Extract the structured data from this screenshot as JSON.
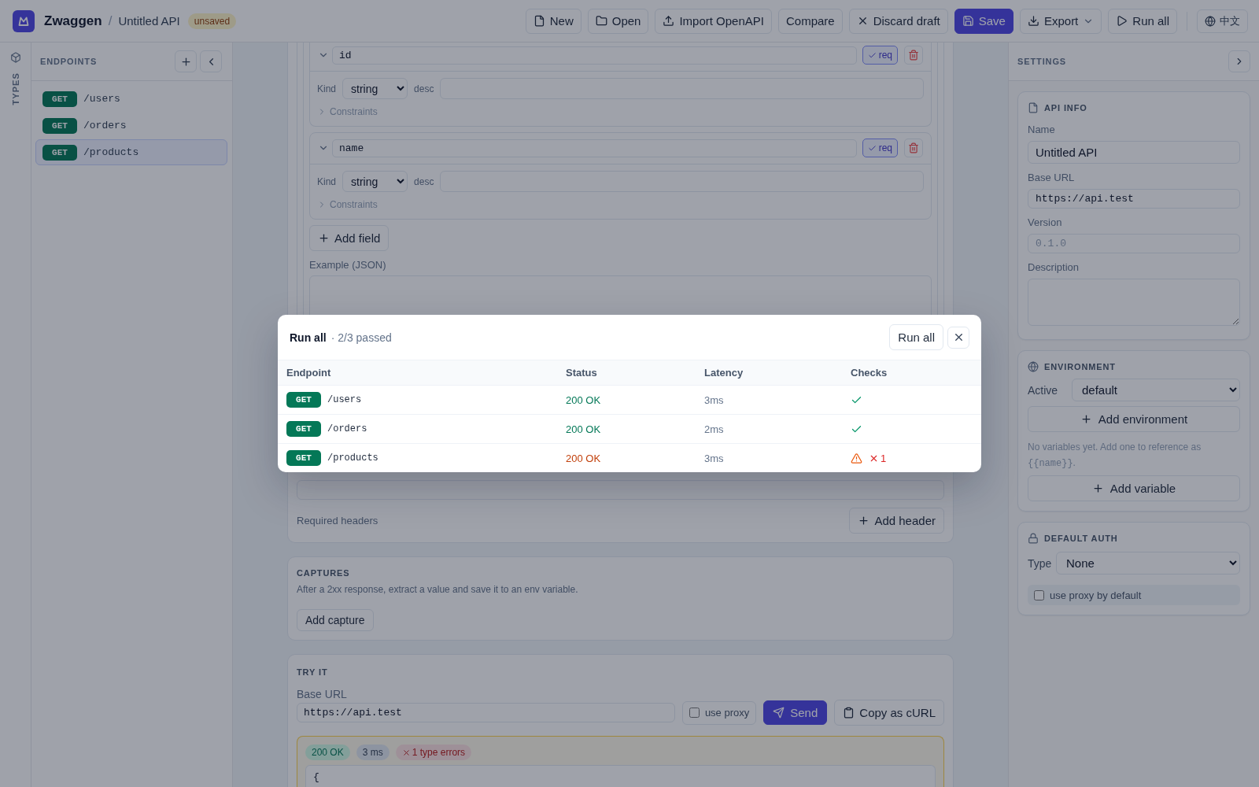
{
  "topbar": {
    "app_name": "Zwaggen",
    "separator": "/",
    "api_name": "Untitled API",
    "status_badge": "unsaved",
    "actions": [
      {
        "label": "New",
        "kind": "default"
      },
      {
        "label": "Open",
        "kind": "default"
      },
      {
        "label": "Import OpenAPI",
        "kind": "default"
      },
      {
        "label": "Compare",
        "kind": "default"
      },
      {
        "label": "Discard draft",
        "kind": "default"
      },
      {
        "label": "Save",
        "kind": "primary"
      },
      {
        "label": "Export",
        "kind": "menu"
      },
      {
        "label": "Run all",
        "kind": "default"
      }
    ],
    "language": "中文"
  },
  "rail": {
    "label": "TYPES"
  },
  "sidebar": {
    "title": "ENDPOINTS",
    "items": [
      {
        "method": "GET",
        "path": "/users",
        "selected": false
      },
      {
        "method": "GET",
        "path": "/orders",
        "selected": false
      },
      {
        "method": "GET",
        "path": "/products",
        "selected": true
      }
    ]
  },
  "editor": {
    "fields": [
      {
        "name": "id",
        "expanded": true,
        "required": true,
        "required_label": "req",
        "kind_label": "Kind",
        "type": "string",
        "desc_label": "desc",
        "constraints": {
          "label": "Constraints",
          "expanded": false
        }
      },
      {
        "name": "name",
        "expanded": true,
        "required": true,
        "required_label": "req",
        "kind_label": "Kind",
        "type": "string",
        "desc_label": "desc",
        "constraints": {
          "label": "Constraints",
          "expanded": false
        }
      }
    ],
    "add_field": "Add field",
    "example_label": "Example (JSON)",
    "required_headers_label": "Required headers",
    "add_header": "Add header"
  },
  "captures": {
    "title": "CAPTURES",
    "description": "After a 2xx response, extract a value and save it to an env variable.",
    "add_capture": "Add capture"
  },
  "try_it": {
    "title": "TRY IT",
    "base_url_label": "Base URL",
    "base_url": "https://api.test",
    "proxy": {
      "label": "use proxy",
      "checked": false
    },
    "send": "Send",
    "copy_curl": "Copy as cURL",
    "response": {
      "status": "200 OK",
      "time": "3 ms",
      "errors": "1 type errors",
      "body_lines": [
        "{"
      ]
    }
  },
  "settings": {
    "title": "SETTINGS",
    "api_info": {
      "title": "API INFO",
      "name_label": "Name",
      "name": "Untitled API",
      "base_url_label": "Base URL",
      "base_url": "https://api.test",
      "version_label": "Version",
      "version_placeholder": "0.1.0",
      "description_label": "Description"
    },
    "environment": {
      "title": "ENVIRONMENT",
      "active_label": "Active",
      "active": "default",
      "add_environment": "Add environment",
      "hint": {
        "text": "No variables yet. Add one to reference as",
        "code": "{{name}}",
        "end": "."
      },
      "add_variable": "Add variable"
    },
    "default_auth": {
      "title": "DEFAULT AUTH",
      "type_label": "Type",
      "type": "None",
      "proxy": {
        "label": "use proxy by default",
        "checked": false
      }
    }
  },
  "run_all_dialog": {
    "title": "Run all",
    "summary": "· 2/3 passed",
    "run_button": "Run all",
    "columns": [
      "Endpoint",
      "Status",
      "Latency",
      "Checks"
    ],
    "rows": [
      {
        "method": "GET",
        "path": "/users",
        "status": "200 OK",
        "latency": "3ms",
        "passed": true
      },
      {
        "method": "GET",
        "path": "/orders",
        "status": "200 OK",
        "latency": "2ms",
        "passed": true
      },
      {
        "method": "GET",
        "path": "/products",
        "status": "200 OK",
        "latency": "3ms",
        "passed": false,
        "failures": "1"
      }
    ]
  }
}
